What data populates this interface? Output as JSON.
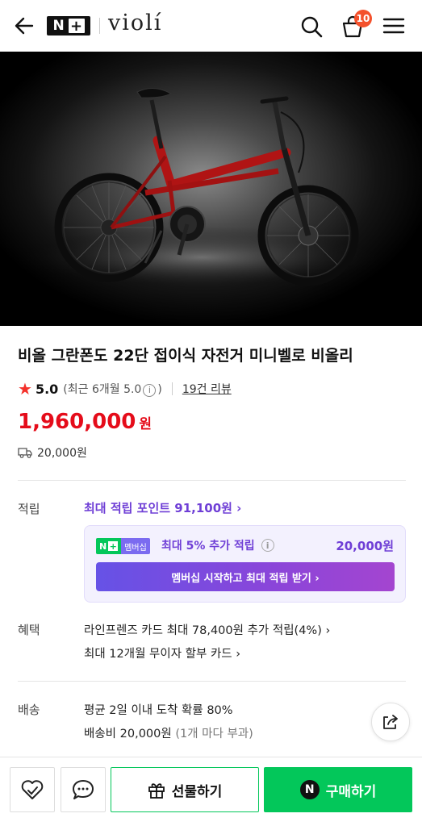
{
  "header": {
    "logo_n": "N",
    "logo_plus": "+",
    "brand": "violí",
    "cart_count": "10"
  },
  "product": {
    "title": "비올 그란폰도 22단 접이식 자전거 미니벨로 비올리",
    "rating": "5.0",
    "rating_sub": "(최근 6개월 5.0",
    "rating_sub_end": ")",
    "info_glyph": "i",
    "review_link": "19건 리뷰",
    "price": "1,960,000",
    "price_unit": "원",
    "shipping": "20,000원"
  },
  "points": {
    "label": "적립",
    "link": "최대 적립 포인트 91,100원 ›",
    "badge_n": "N",
    "badge_plus": "+",
    "badge_text": "멤버십",
    "member_text": "최대 5% 추가 적립",
    "member_amount": "20,000원",
    "cta": "멤버십 시작하고 최대 적립 받기 ›"
  },
  "benefits": {
    "label": "혜택",
    "line1": "라인프렌즈 카드 최대 78,400원 추가 적립(4%) ›",
    "line2": "최대 12개월 무이자 할부 카드 ›"
  },
  "delivery": {
    "label": "배송",
    "line1": "평균 2일 이내 도착 확률 80%",
    "line2": "배송비 20,000원",
    "line2_note": "(1개 마다 부과)"
  },
  "bottom": {
    "gift": "선물하기",
    "buy": "구매하기",
    "buy_n": "N"
  },
  "colors": {
    "price": "#e50c1a",
    "accent_purple": "#6f3fd6",
    "naver_green": "#03c75a"
  }
}
